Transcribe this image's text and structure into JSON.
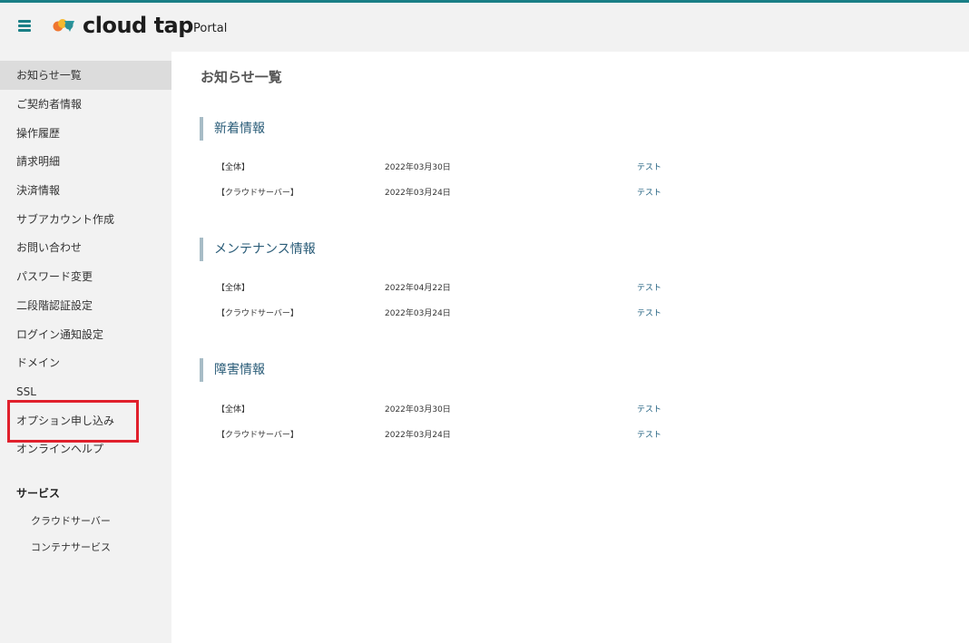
{
  "header": {
    "logo_text": "cloud tap",
    "portal_label": "Portal",
    "menu_icon": "hamburger-icon",
    "accent_color": "#1a7f86"
  },
  "sidebar": {
    "items": [
      {
        "label": "お知らせ一覧",
        "active": true
      },
      {
        "label": "ご契約者情報"
      },
      {
        "label": "操作履歴"
      },
      {
        "label": "請求明細"
      },
      {
        "label": "決済情報"
      },
      {
        "label": "サブアカウント作成"
      },
      {
        "label": "お問い合わせ"
      },
      {
        "label": "パスワード変更"
      },
      {
        "label": "二段階認証設定"
      },
      {
        "label": "ログイン通知設定"
      },
      {
        "label": "ドメイン"
      },
      {
        "label": "SSL"
      },
      {
        "label": "オプション申し込み",
        "highlighted": true
      },
      {
        "label": "オンラインヘルプ"
      }
    ],
    "services_heading": "サービス",
    "services": [
      {
        "label": "クラウドサーバー"
      },
      {
        "label": "コンテナサービス"
      }
    ]
  },
  "main": {
    "page_title": "お知らせ一覧",
    "sections": [
      {
        "title": "新着情報",
        "rows": [
          {
            "category": "【全体】",
            "date": "2022年03月30日",
            "link": "テスト"
          },
          {
            "category": "【クラウドサーバー】",
            "date": "2022年03月24日",
            "link": "テスト"
          }
        ]
      },
      {
        "title": "メンテナンス情報",
        "rows": [
          {
            "category": "【全体】",
            "date": "2022年04月22日",
            "link": "テスト"
          },
          {
            "category": "【クラウドサーバー】",
            "date": "2022年03月24日",
            "link": "テスト"
          }
        ]
      },
      {
        "title": "障害情報",
        "rows": [
          {
            "category": "【全体】",
            "date": "2022年03月30日",
            "link": "テスト"
          },
          {
            "category": "【クラウドサーバー】",
            "date": "2022年03月24日",
            "link": "テスト"
          }
        ]
      }
    ]
  },
  "colors": {
    "highlight_box": "#e0202c",
    "section_bar": "#a7bcc6",
    "link": "#1f5f7f"
  }
}
